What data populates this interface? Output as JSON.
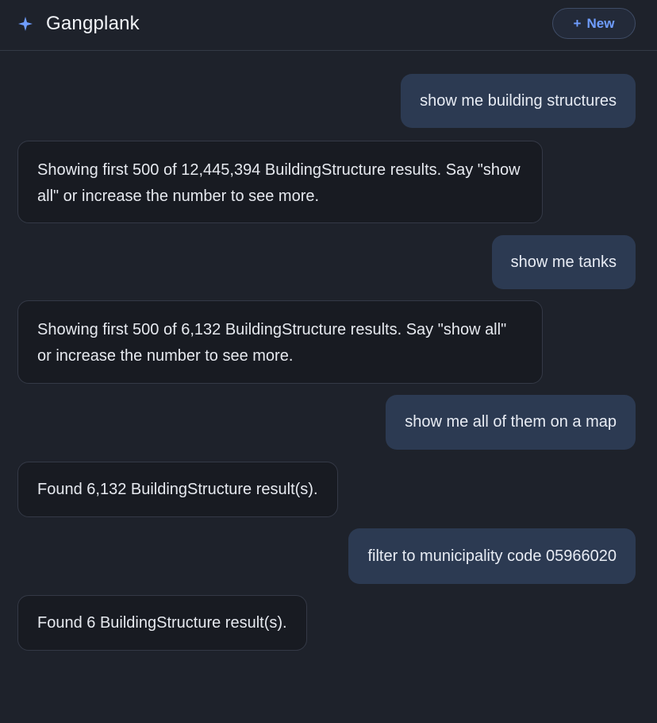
{
  "app": {
    "title": "Gangplank",
    "icon": "sparkle-icon",
    "accent_color": "#6f9dff"
  },
  "header": {
    "new_button_label": "New",
    "new_button_icon": "plus-icon"
  },
  "messages": [
    {
      "role": "user",
      "text": "show me building structures"
    },
    {
      "role": "assistant",
      "text": "Showing first 500 of 12,445,394 BuildingStructure results. Say \"show all\" or increase the number to see more."
    },
    {
      "role": "user",
      "text": "show me tanks"
    },
    {
      "role": "assistant",
      "text": "Showing first 500 of 6,132 BuildingStructure results. Say \"show all\" or increase the number to see more."
    },
    {
      "role": "user",
      "text": "show me all of them on a map"
    },
    {
      "role": "assistant",
      "text": "Found 6,132 BuildingStructure result(s)."
    },
    {
      "role": "user",
      "text": "filter to municipality code 05966020"
    },
    {
      "role": "assistant",
      "text": "Found 6 BuildingStructure result(s)."
    }
  ]
}
